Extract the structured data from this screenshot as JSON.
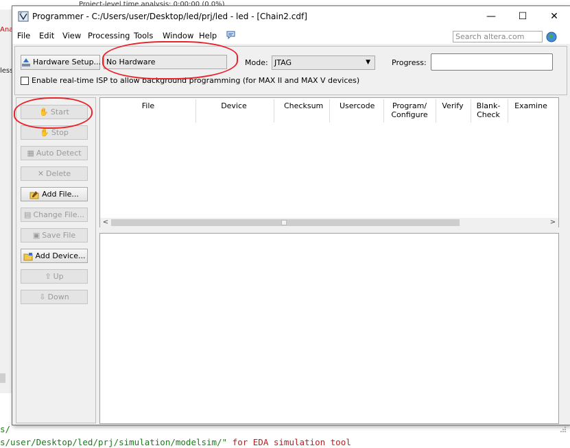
{
  "background": {
    "top_text": "Project-level time analysis: 0:00:00 (0.0%)",
    "left_text_top": "Ana",
    "left_text_mid": "less",
    "console_line1": "s/",
    "console_line2_prefix": "s/user/Desktop/led/prj/simulation/modelsim/\"",
    "console_line2_suffix": " for EDA simulation tool"
  },
  "window": {
    "title": "Programmer - C:/Users/user/Desktop/led/prj/led - led - [Chain2.cdf]",
    "controls": {
      "minimize": "—",
      "maximize": "☐",
      "close": "✕"
    }
  },
  "menu": {
    "file": "File",
    "edit": "Edit",
    "view": "View",
    "processing": "Processing",
    "tools": "Tools",
    "window": "Window",
    "help": "Help"
  },
  "search": {
    "placeholder": "Search altera.com"
  },
  "hardware": {
    "setup_label": "Hardware Setup...",
    "current": "No Hardware",
    "mode_label": "Mode:",
    "mode_value": "JTAG",
    "progress_label": "Progress:",
    "isp_label": "Enable real-time ISP to allow background programming (for MAX II and MAX V devices)",
    "isp_checked": false
  },
  "side_buttons": {
    "start": "Start",
    "stop": "Stop",
    "auto_detect": "Auto Detect",
    "delete": "Delete",
    "add_file": "Add File...",
    "change_file": "Change File...",
    "save_file": "Save File",
    "add_device": "Add Device...",
    "up": "Up",
    "down": "Down"
  },
  "table": {
    "columns": [
      "File",
      "Device",
      "Checksum",
      "Usercode",
      "Program/\nConfigure",
      "Verify",
      "Blank-\nCheck",
      "Examine"
    ],
    "col_file": "File",
    "col_device": "Device",
    "col_checksum": "Checksum",
    "col_usercode": "Usercode",
    "col_program_1": "Program/",
    "col_program_2": "Configure",
    "col_verify": "Verify",
    "col_blank_1": "Blank-",
    "col_blank_2": "Check",
    "col_examine": "Examine"
  },
  "colors": {
    "annotation": "#e8232a",
    "window_bg": "#f0f0f0"
  }
}
